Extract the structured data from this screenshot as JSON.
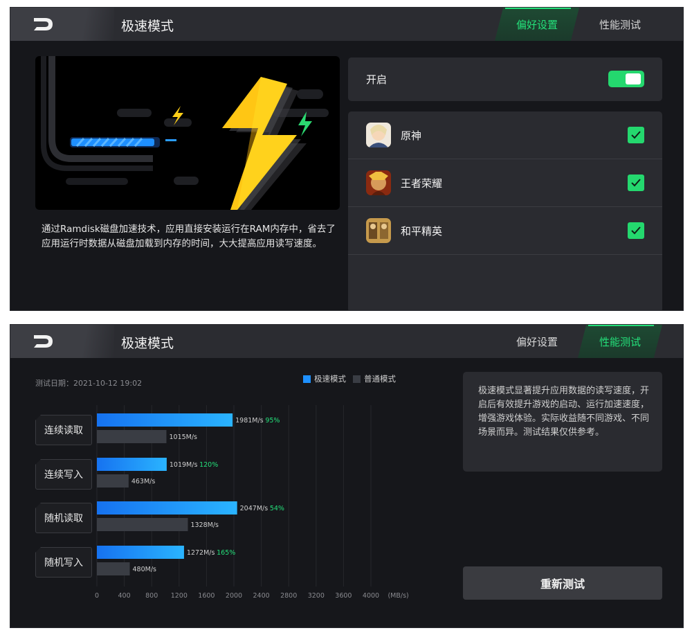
{
  "screen1": {
    "header": {
      "title": "极速模式",
      "tabs": [
        {
          "label": "偏好设置",
          "active": true
        },
        {
          "label": "性能测试",
          "active": false
        }
      ]
    },
    "description": "通过Ramdisk磁盘加速技术，应用直接安装运行在RAM内存中，省去了应用运行时数据从磁盘加载到内存的时间，大大提高应用读写速度。",
    "toggle": {
      "label": "开启",
      "on": true
    },
    "apps": [
      {
        "name": "原神",
        "checked": true
      },
      {
        "name": "王者荣耀",
        "checked": true
      },
      {
        "name": "和平精英",
        "checked": true
      }
    ]
  },
  "screen2": {
    "header": {
      "title": "极速模式",
      "tabs": [
        {
          "label": "偏好设置",
          "active": false
        },
        {
          "label": "性能测试",
          "active": true
        }
      ]
    },
    "test_date": "测试日期：2021-10-12 19:02",
    "legend": {
      "fast": "极速模式",
      "normal": "普通模式"
    },
    "categories": [
      "连续读取",
      "连续写入",
      "随机读取",
      "随机写入"
    ],
    "note": "极速模式显著提升应用数据的读写速度，开启后有效提升游戏的启动、运行加速速度，增强游戏体验。实际收益随不同游戏、不同场景而异。测试结果仅供参考。",
    "retest_label": "重新测试"
  },
  "chart_data": {
    "type": "bar",
    "orientation": "horizontal",
    "categories": [
      "连续读取",
      "连续写入",
      "随机读取",
      "随机写入"
    ],
    "series": [
      {
        "name": "极速模式",
        "values": [
          1981,
          1019,
          2047,
          1272
        ],
        "labels": [
          "1981M/s",
          "1019M/s",
          "2047M/s",
          "1272M/s"
        ],
        "gains": [
          "95%",
          "120%",
          "54%",
          "165%"
        ]
      },
      {
        "name": "普通模式",
        "values": [
          1015,
          463,
          1328,
          480
        ],
        "labels": [
          "1015M/s",
          "463M/s",
          "1328M/s",
          "480M/s"
        ]
      }
    ],
    "x_ticks": [
      "0",
      "400",
      "800",
      "1200",
      "1600",
      "2000",
      "2400",
      "2800",
      "3200",
      "3600",
      "4000"
    ],
    "x_unit": "(MB/s)",
    "xlim": [
      0,
      4500
    ],
    "grid": true
  },
  "colors": {
    "accent_green": "#24e07a",
    "fast_bar": "#1e90ff",
    "normal_bar": "#3a3d44",
    "gain_text": "#24e07a"
  }
}
